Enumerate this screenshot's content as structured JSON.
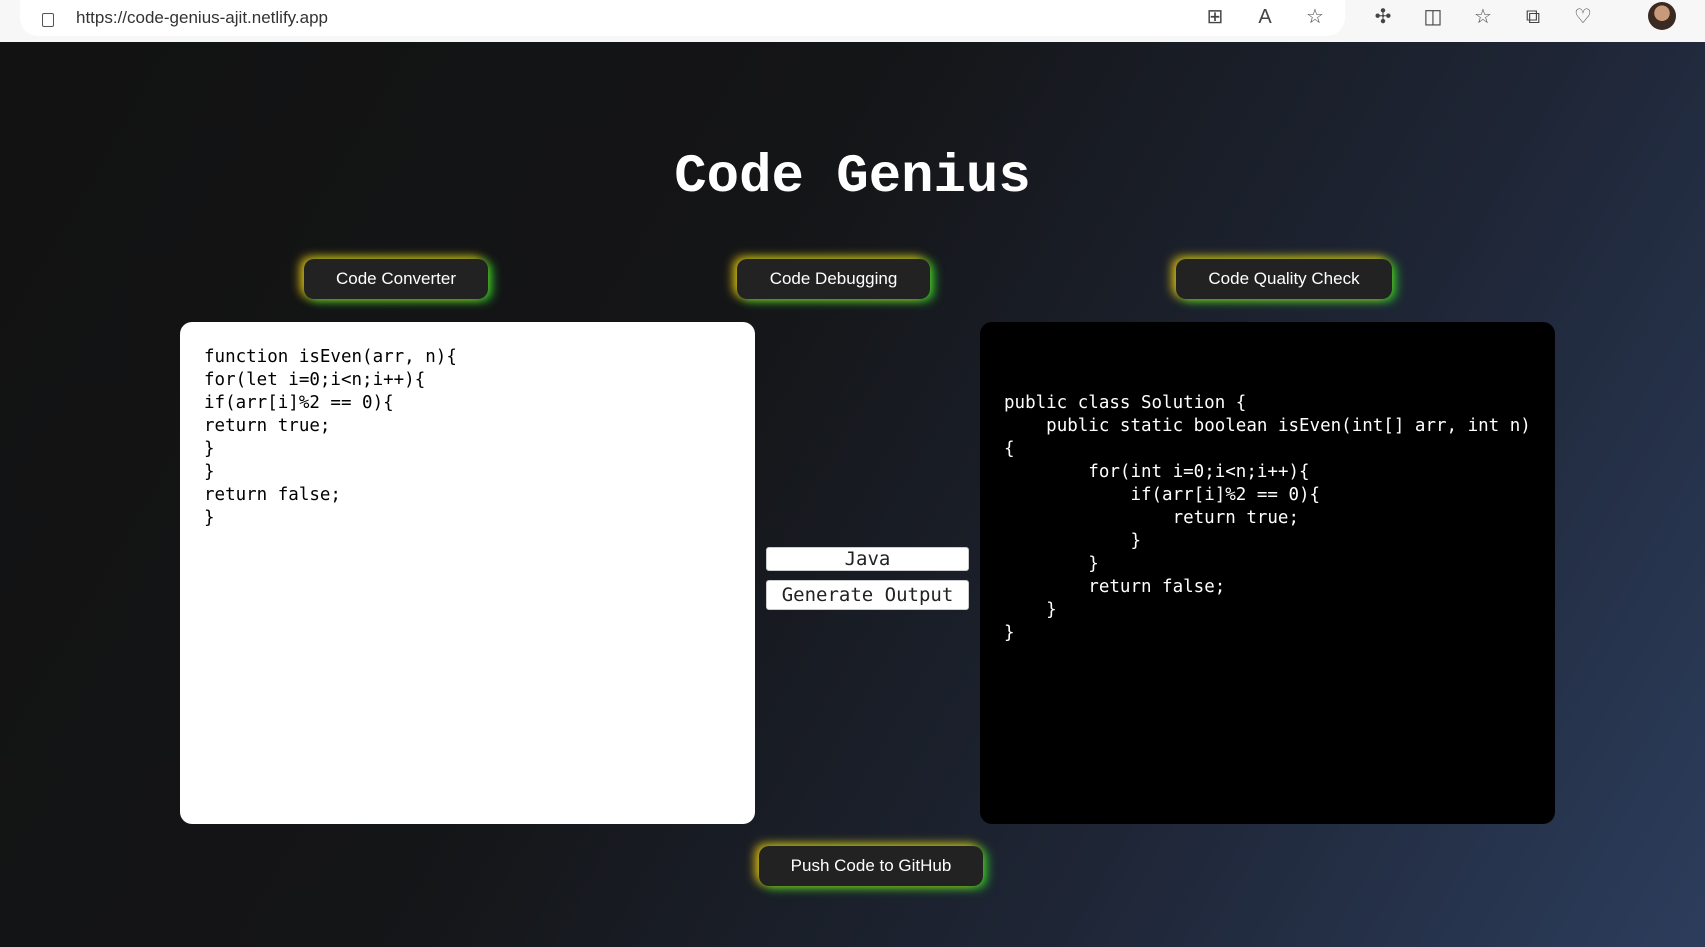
{
  "browser": {
    "url": "https://code-genius-ajit.netlify.app",
    "icons": [
      "lock-icon",
      "app-grid-icon",
      "read-aloud-icon",
      "favorite-star-icon",
      "extensions-icon",
      "split-screen-icon",
      "favorites-list-icon",
      "collections-icon",
      "health-icon",
      "profile-avatar"
    ]
  },
  "app": {
    "title": "Code Genius",
    "nav": {
      "converter": "Code Converter",
      "debugging": "Code Debugging",
      "quality": "Code Quality Check"
    },
    "input_code": "function isEven(arr, n){\nfor(let i=0;i<n;i++){\nif(arr[i]%2 == 0){\nreturn true;\n}\n}\nreturn false;\n}",
    "output_code": "public class Solution {\n    public static boolean isEven(int[] arr, int n) {\n        for(int i=0;i<n;i++){\n            if(arr[i]%2 == 0){\n                return true;\n            }\n        }\n        return false;\n    }\n}",
    "language": "Java",
    "generate_label": "Generate Output",
    "push_label": "Push Code to GitHub",
    "colors": {
      "glow_yellow": "#d6b414",
      "glow_green": "#27c22b",
      "button_bg": "#222222"
    }
  }
}
